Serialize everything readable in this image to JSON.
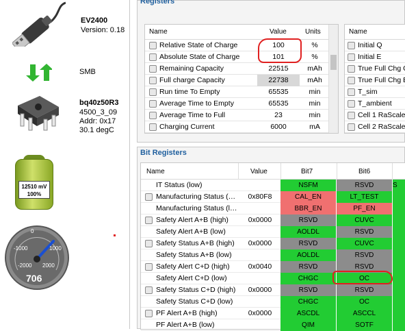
{
  "device": {
    "name": "EV2400",
    "version": "Version: 0.18",
    "bus": "SMB",
    "chip": "bq40z50R3",
    "fw": "4500_3_09",
    "addr": "Addr: 0x17",
    "temp": "30.1 degC",
    "battery_line1": "12510 mV",
    "battery_line2": "100%",
    "gauge_value": "706",
    "gauge_ticks": [
      "-1000",
      "1000",
      "-2000",
      "2000",
      "0"
    ]
  },
  "registers": {
    "title": "Registers",
    "col_name": "Name",
    "col_value": "Value",
    "col_units": "Units",
    "col_name2": "Name",
    "rows": [
      {
        "name": "Relative State of Charge",
        "value": "100",
        "units": "%"
      },
      {
        "name": "Absolute State of Charge",
        "value": "101",
        "units": "%"
      },
      {
        "name": "Remaining Capacity",
        "value": "22515",
        "units": "mAh"
      },
      {
        "name": "Full charge Capacity",
        "value": "22738",
        "units": "mAh"
      },
      {
        "name": "Run time To Empty",
        "value": "65535",
        "units": "min"
      },
      {
        "name": "Average Time to Empty",
        "value": "65535",
        "units": "min"
      },
      {
        "name": "Average Time to Full",
        "value": "23",
        "units": "min"
      },
      {
        "name": "Charging Current",
        "value": "6000",
        "units": "mA"
      }
    ],
    "right_rows": [
      "Initial Q",
      "Initial E",
      "True Full Chg C",
      "True Full Chg E",
      "T_sim",
      "T_ambient",
      "Cell 1 RaScale",
      "Cell 2 RaScale"
    ]
  },
  "bit_registers": {
    "title": "Bit Registers",
    "col_name": "Name",
    "col_value": "Value",
    "col_bit7": "Bit7",
    "col_bit6": "Bit6",
    "rows": [
      {
        "name": "IT Status (low)",
        "value": "",
        "b7": "NSFM",
        "b6": "RSVD",
        "c7": "g",
        "c6": "gr",
        "c5": "g",
        "b5": "S"
      },
      {
        "name": "Manufacturing Status (…",
        "value": "0x80F8",
        "b7": "CAL_EN",
        "b6": "LT_TEST",
        "c7": "r",
        "c6": "g",
        "c5": "g",
        "b5": ""
      },
      {
        "name": "Manufacturing Status (l…",
        "value": "",
        "b7": "BBR_EN",
        "b6": "PF_EN",
        "c7": "r",
        "c6": "r",
        "c5": "g",
        "b5": ""
      },
      {
        "name": "Safety Alert A+B (high)",
        "value": "0x0000",
        "b7": "RSVD",
        "b6": "CUVC",
        "c7": "gr",
        "c6": "g",
        "c5": "g",
        "b5": ""
      },
      {
        "name": "Safety Alert A+B (low)",
        "value": "",
        "b7": "AOLDL",
        "b6": "RSVD",
        "c7": "g",
        "c6": "gr",
        "c5": "g",
        "b5": ""
      },
      {
        "name": "Safety Status A+B (high)",
        "value": "0x0000",
        "b7": "RSVD",
        "b6": "CUVC",
        "c7": "gr",
        "c6": "g",
        "c5": "g",
        "b5": ""
      },
      {
        "name": "Safety Status A+B (low)",
        "value": "",
        "b7": "AOLDL",
        "b6": "RSVD",
        "c7": "g",
        "c6": "gr",
        "c5": "g",
        "b5": ""
      },
      {
        "name": "Safety Alert C+D (high)",
        "value": "0x0040",
        "b7": "RSVD",
        "b6": "RSVD",
        "c7": "gr",
        "c6": "gr",
        "c5": "g",
        "b5": ""
      },
      {
        "name": "Safety Alert C+D (low)",
        "value": "",
        "b7": "CHGC",
        "b6": "OC",
        "c7": "g",
        "c6": "g",
        "c5": "g",
        "b5": ""
      },
      {
        "name": "Safety Status C+D (high)",
        "value": "0x0000",
        "b7": "RSVD",
        "b6": "RSVD",
        "c7": "gr",
        "c6": "gr",
        "c5": "g",
        "b5": ""
      },
      {
        "name": "Safety Status C+D (low)",
        "value": "",
        "b7": "CHGC",
        "b6": "OC",
        "c7": "g",
        "c6": "g",
        "c5": "g",
        "b5": ""
      },
      {
        "name": "PF Alert A+B (high)",
        "value": "0x0000",
        "b7": "ASCDL",
        "b6": "ASCCL",
        "c7": "g",
        "c6": "g",
        "c5": "g",
        "b5": ""
      },
      {
        "name": "PF Alert A+B (low)",
        "value": "",
        "b7": "QIM",
        "b6": "SOTF",
        "c7": "g",
        "c6": "g",
        "c5": "g",
        "b5": ""
      }
    ]
  }
}
